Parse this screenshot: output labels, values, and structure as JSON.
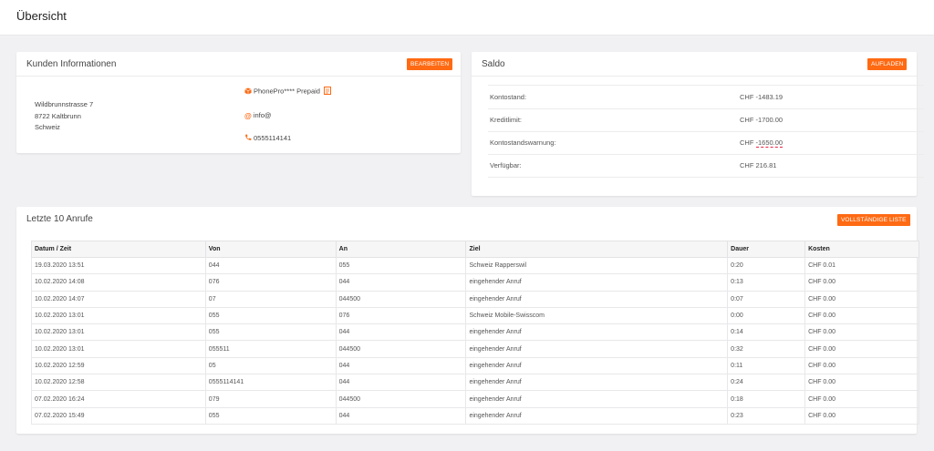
{
  "page": {
    "title": "Übersicht"
  },
  "customer": {
    "title": "Kunden Informationen",
    "edit_label": "BEARBEITEN",
    "address": [
      "Wildbrunnstrasse 7",
      "8722 Kaltbrunn",
      "Schweiz"
    ],
    "product": "PhonePro**** Prepaid",
    "email": "info@",
    "phone": "0555114141",
    "accent": "#ff6a13"
  },
  "balance": {
    "title": "Saldo",
    "topup_label": "AUFLADEN",
    "rows": [
      {
        "label": "Kontostand:",
        "value": "CHF -1483.19"
      },
      {
        "label": "Kreditlimit:",
        "value": "CHF -1700.00"
      },
      {
        "label": "Kontostandswarnung:",
        "value_prefix": "CHF ",
        "value": "-1650.00"
      },
      {
        "label": "Verfügbar:",
        "value": "CHF 216.81"
      }
    ]
  },
  "calls": {
    "title": "Letzte 10 Anrufe",
    "full_list_label": "VOLLSTÄNDIGE LISTE",
    "columns": [
      "Datum / Zeit",
      "Von",
      "An",
      "Ziel",
      "Dauer",
      "Kosten"
    ],
    "rows": [
      [
        "19.03.2020 13:51",
        "044",
        "055",
        "Schweiz Rapperswil",
        "0:20",
        "CHF 0.01"
      ],
      [
        "10.02.2020 14:08",
        "076",
        "044",
        "eingehender Anruf",
        "0:13",
        "CHF 0.00"
      ],
      [
        "10.02.2020 14:07",
        "07",
        "044500",
        "eingehender Anruf",
        "0:07",
        "CHF 0.00"
      ],
      [
        "10.02.2020 13:01",
        "055",
        "076",
        "Schweiz Mobile-Swisscom",
        "0:00",
        "CHF 0.00"
      ],
      [
        "10.02.2020 13:01",
        "055",
        "044",
        "eingehender Anruf",
        "0:14",
        "CHF 0.00"
      ],
      [
        "10.02.2020 13:01",
        "055511",
        "044500",
        "eingehender Anruf",
        "0:32",
        "CHF 0.00"
      ],
      [
        "10.02.2020 12:59",
        "05",
        "044",
        "eingehender Anruf",
        "0:11",
        "CHF 0.00"
      ],
      [
        "10.02.2020 12:58",
        "0555114141",
        "044",
        "eingehender Anruf",
        "0:24",
        "CHF 0.00"
      ],
      [
        "07.02.2020 16:24",
        "079",
        "044500",
        "eingehender Anruf",
        "0:18",
        "CHF 0.00"
      ],
      [
        "07.02.2020 15:49",
        "055",
        "044",
        "eingehender Anruf",
        "0:23",
        "CHF 0.00"
      ]
    ]
  }
}
